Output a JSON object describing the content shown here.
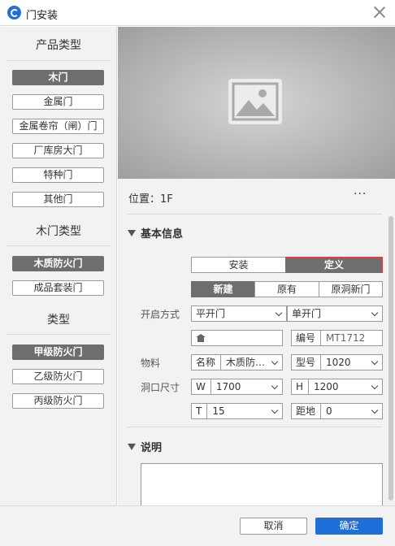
{
  "window": {
    "title": "门安装"
  },
  "sidebar": {
    "sections": [
      {
        "title": "产品类型",
        "items": [
          "木门",
          "金属门",
          "金属卷帘（闸）门",
          "厂库房大门",
          "特种门",
          "其他门"
        ],
        "active": 0
      },
      {
        "title": "木门类型",
        "items": [
          "木质防火门",
          "成品套装门"
        ],
        "active": 0
      },
      {
        "title": "类型",
        "items": [
          "甲级防火门",
          "乙级防火门",
          "丙级防火门"
        ],
        "active": 0
      }
    ]
  },
  "location": {
    "label": "位置：",
    "value": "1F",
    "more": "···"
  },
  "basic": {
    "title": "基本信息",
    "mode_tabs": [
      "安装",
      "定义"
    ],
    "mode_active": 1,
    "source_tabs": [
      "新建",
      "原有",
      "原洞新门"
    ],
    "source_active": 0,
    "open_label": "开启方式",
    "open_type": "平开门",
    "leaf_type": "单开门",
    "code_label": "编号",
    "code_value": "MT1712",
    "material_label": "物料",
    "name_label": "名称",
    "name_value": "木质防…",
    "model_label": "型号",
    "model_value": "1020",
    "size_label": "洞口尺寸",
    "w_label": "W",
    "w_value": "1700",
    "h_label": "H",
    "h_value": "1200",
    "t_label": "T",
    "t_value": "15",
    "gap_label": "距地",
    "gap_value": "0"
  },
  "desc": {
    "title": "说明"
  },
  "footer": {
    "cancel": "取消",
    "ok": "确定"
  },
  "colors": {
    "accent": "#1e6fd9",
    "active": "#6e6e6e",
    "highlight": "#e04040"
  }
}
